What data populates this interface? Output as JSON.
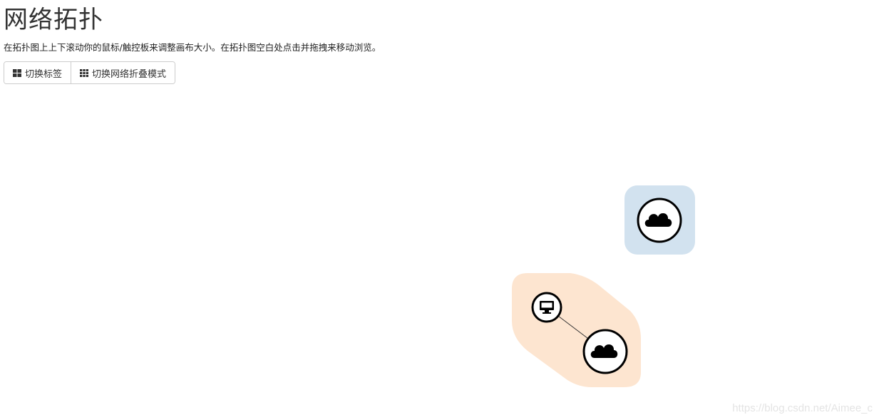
{
  "header": {
    "title": "网络拓扑",
    "description": "在拓扑图上上下滚动你的鼠标/触控板来调整画布大小。在拓扑图空白处点击并拖拽来移动浏览。"
  },
  "toolbar": {
    "toggle_labels": {
      "label": "切换标签",
      "icon": "th-large-icon"
    },
    "toggle_collapse": {
      "label": "切换网络折叠模式",
      "icon": "th-icon"
    }
  },
  "topology": {
    "groups": [
      {
        "id": "network-group-1",
        "color": "#d2e2ef",
        "nodes": [
          "cloud-node-1"
        ]
      },
      {
        "id": "network-group-2",
        "color": "#fde5d0",
        "nodes": [
          "monitor-node",
          "cloud-node-2"
        ]
      }
    ],
    "nodes": [
      {
        "id": "cloud-node-1",
        "icon": "cloud-icon"
      },
      {
        "id": "monitor-node",
        "icon": "monitor-icon"
      },
      {
        "id": "cloud-node-2",
        "icon": "cloud-icon"
      }
    ],
    "links": [
      {
        "from": "monitor-node",
        "to": "cloud-node-2"
      }
    ]
  },
  "watermark": "https://blog.csdn.net/Aimee_c"
}
